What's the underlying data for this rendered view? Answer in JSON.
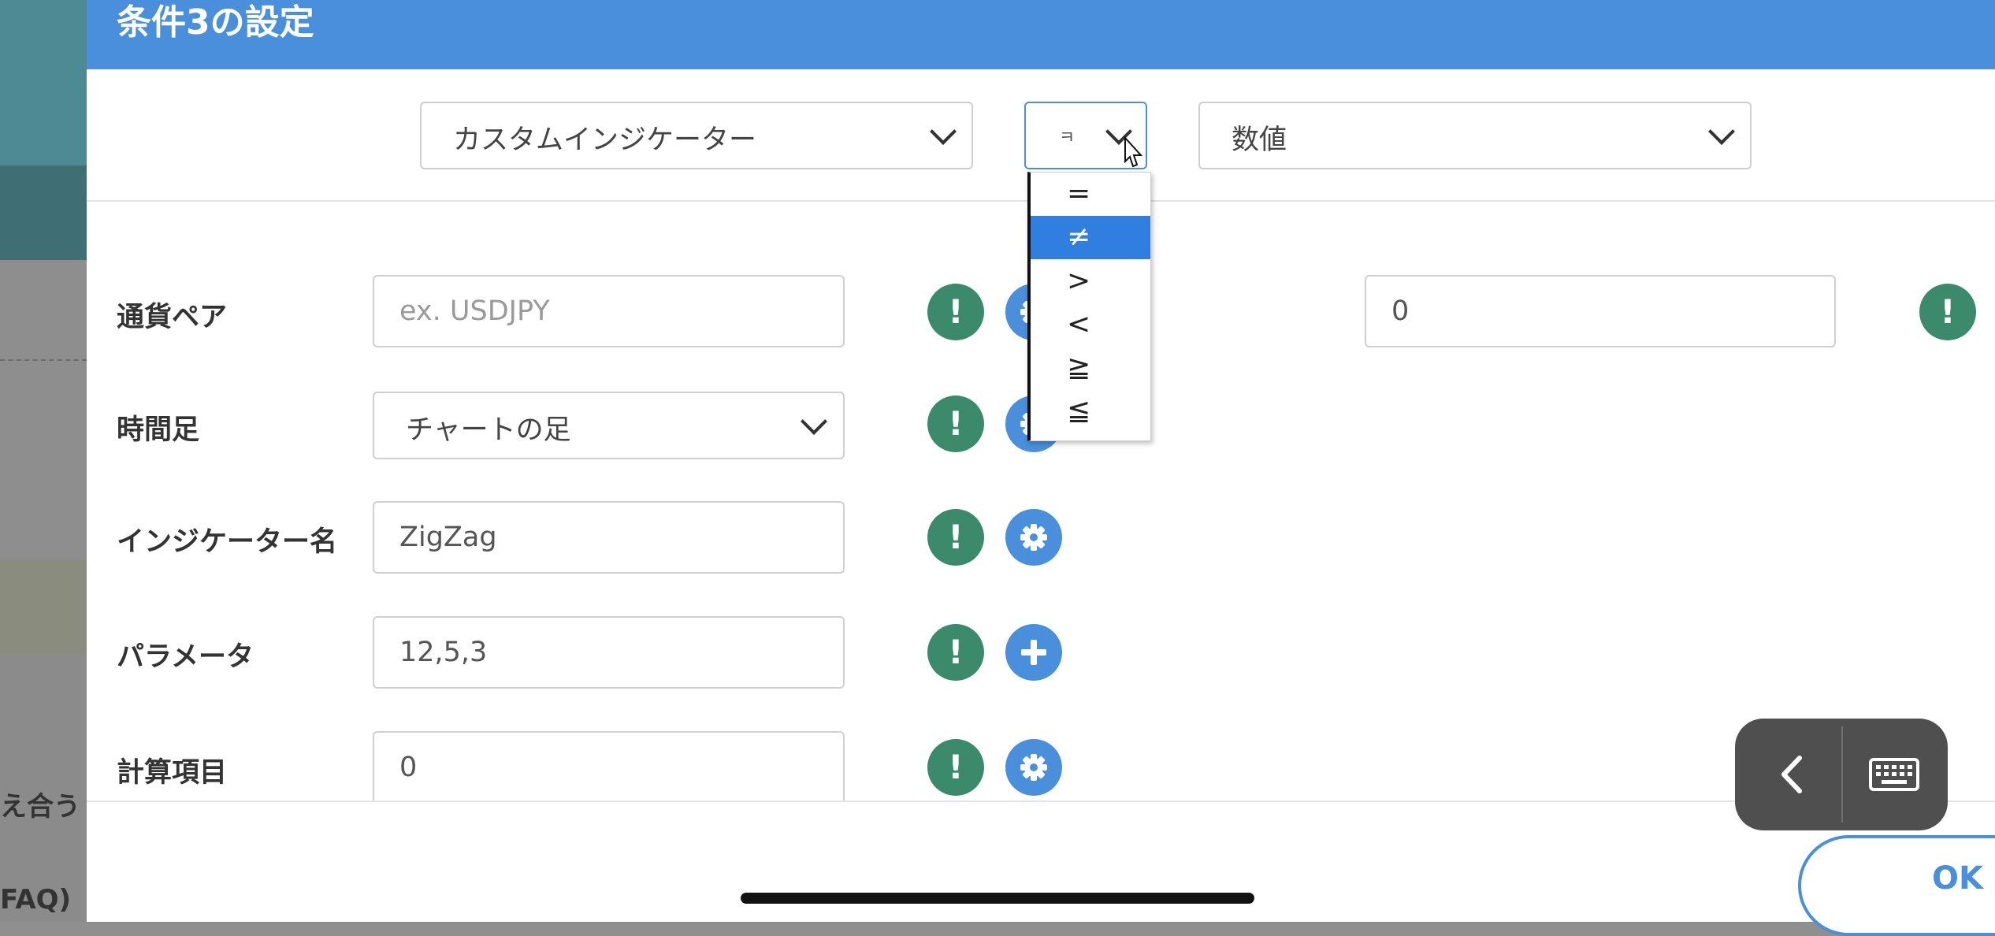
{
  "background_page": {
    "text_1": "え合う",
    "text_2": "FAQ)"
  },
  "dialog": {
    "title": "条件3の設定",
    "top_row": {
      "left_select": "カスタムインジケーター",
      "operator_select": "ㅋ",
      "right_select": "数値"
    },
    "operator_dropdown": {
      "options": [
        "=",
        "≠",
        ">",
        "<",
        "≧",
        "≦"
      ],
      "selected_index": 1
    },
    "right_value_input": "0",
    "rows": [
      {
        "label": "通貨ペア",
        "placeholder": "ex. USDJPY",
        "value": ""
      },
      {
        "label": "時間足",
        "value": "チャートの足"
      },
      {
        "label": "インジケーター名",
        "value": "ZigZag"
      },
      {
        "label": "パラメータ",
        "value": "12,5,3"
      },
      {
        "label": "計算項目",
        "value": "0"
      }
    ],
    "info_icon_glyph": "!",
    "ok_label": "OK"
  },
  "colors": {
    "header_blue": "#4a8fdb",
    "info_green": "#3a8a6b",
    "selected_option": "#2f7ee0"
  },
  "icons": [
    "info-icon",
    "gear-icon",
    "plus-icon",
    "chevron-down-icon",
    "back-arrow-icon",
    "keyboard-icon",
    "mouse-cursor-icon"
  ]
}
